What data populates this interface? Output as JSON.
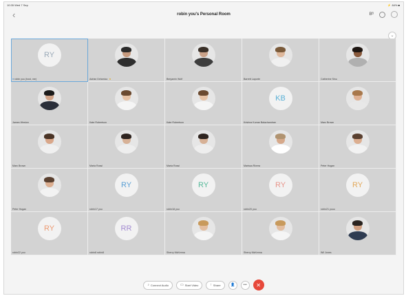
{
  "status_bar": {
    "time": "10:35 Wed 7 Sep",
    "battery": "⚡ 84% ■"
  },
  "header": {
    "back_label": "‹",
    "title": "robin you's Personal Room",
    "bluetooth_label": "Bᴮ",
    "info_label": "i",
    "pip_label": "○"
  },
  "minimize_label": "⌄",
  "participants": [
    {
      "name": "robin you (host, me)",
      "type": "initials",
      "initials": "RY",
      "color": "#9aaab8",
      "active": true,
      "mic": true
    },
    {
      "name": "Adrian Delamico",
      "type": "photo",
      "skin": "#c69a7e",
      "hair": "#2b2b2b",
      "shirt": "#2e2e2e",
      "star": true
    },
    {
      "name": "Benjamin Wolf",
      "type": "photo",
      "skin": "#caa289",
      "hair": "#3a3028",
      "shirt": "#3d3d3d"
    },
    {
      "name": "Barrett Laporte",
      "type": "photo",
      "skin": "#deb89c",
      "hair": "#7a5a3a",
      "shirt": "#f0f0f0"
    },
    {
      "name": "Catherine Sinu",
      "type": "photo",
      "skin": "#8a5a3c",
      "hair": "#1e1612",
      "shirt": "#b0b0b0"
    },
    {
      "name": "James Weston",
      "type": "photo",
      "skin": "#d0a388",
      "hair": "#1a1a1a",
      "shirt": "#2a2f3a"
    },
    {
      "name": "Kate Robertson",
      "type": "photo",
      "skin": "#e7c3a6",
      "hair": "#6b4a30",
      "shirt": "#f5f5f5"
    },
    {
      "name": "Kate Robertson",
      "type": "photo",
      "skin": "#e7c3a6",
      "hair": "#6b4a30",
      "shirt": "#f5f5f5"
    },
    {
      "name": "Krishna Kumar Balachandran",
      "type": "initials",
      "initials": "KB",
      "color": "#5ab0d6"
    },
    {
      "name": "Marc Brown",
      "type": "photo",
      "skin": "#dfb295",
      "hair": "#a8784c",
      "shirt": "#e8e8e8"
    },
    {
      "name": "Marc Brown",
      "type": "photo",
      "skin": "#d9a78a",
      "hair": "#4a3426",
      "shirt": "#f0f0f0"
    },
    {
      "name": "Maria Rossi",
      "type": "photo",
      "skin": "#d7b196",
      "hair": "#2e2420",
      "shirt": "#eeeeee"
    },
    {
      "name": "Maria Rossi",
      "type": "photo",
      "skin": "#d7b196",
      "hair": "#2e2420",
      "shirt": "#eeeeee"
    },
    {
      "name": "Marissa Rivera",
      "type": "photo",
      "skin": "#d6a98b",
      "hair": "#b09370",
      "shirt": "#ffffff"
    },
    {
      "name": "Peter Hogan",
      "type": "photo",
      "skin": "#dcae90",
      "hair": "#5a4030",
      "shirt": "#f2f2f2"
    },
    {
      "name": "Peter Hogan",
      "type": "photo",
      "skin": "#dcae90",
      "hair": "#5a4030",
      "shirt": "#f2f2f2"
    },
    {
      "name": "robin17 you",
      "type": "initials",
      "initials": "RY",
      "color": "#5a9fd4"
    },
    {
      "name": "robin18 you",
      "type": "initials",
      "initials": "RY",
      "color": "#57b99a"
    },
    {
      "name": "robin20 you",
      "type": "initials",
      "initials": "RY",
      "color": "#e8968c"
    },
    {
      "name": "robin21 youu",
      "type": "initials",
      "initials": "RY",
      "color": "#e3a95c"
    },
    {
      "name": "robin22 you",
      "type": "initials",
      "initials": "RY",
      "color": "#ec9a72"
    },
    {
      "name": "robin8 robin8",
      "type": "initials",
      "initials": "RR",
      "color": "#a28ad0"
    },
    {
      "name": "Sherry McKenna",
      "type": "photo",
      "skin": "#e3bea0",
      "hair": "#c89a5c",
      "shirt": "#f5f5f5"
    },
    {
      "name": "Sherry McKenna",
      "type": "photo",
      "skin": "#e3bea0",
      "hair": "#c89a5c",
      "shirt": "#f5f5f5"
    },
    {
      "name": "Wil Jones",
      "type": "photo",
      "skin": "#d0a082",
      "hair": "#2a2420",
      "shirt": "#2f3c52"
    }
  ],
  "controls": {
    "connect_audio": "Connect Audio",
    "start_video": "Start Video",
    "share": "Share",
    "audio_icon": "♪",
    "video_icon": "▭",
    "share_icon": "↑",
    "participants_icon": "👤",
    "more_icon": "•••",
    "end_icon": "✕"
  },
  "colors": {
    "end_call": "#e7483a",
    "active_outline": "#6aa7d9",
    "tile_bg": "#d3d3d3"
  }
}
